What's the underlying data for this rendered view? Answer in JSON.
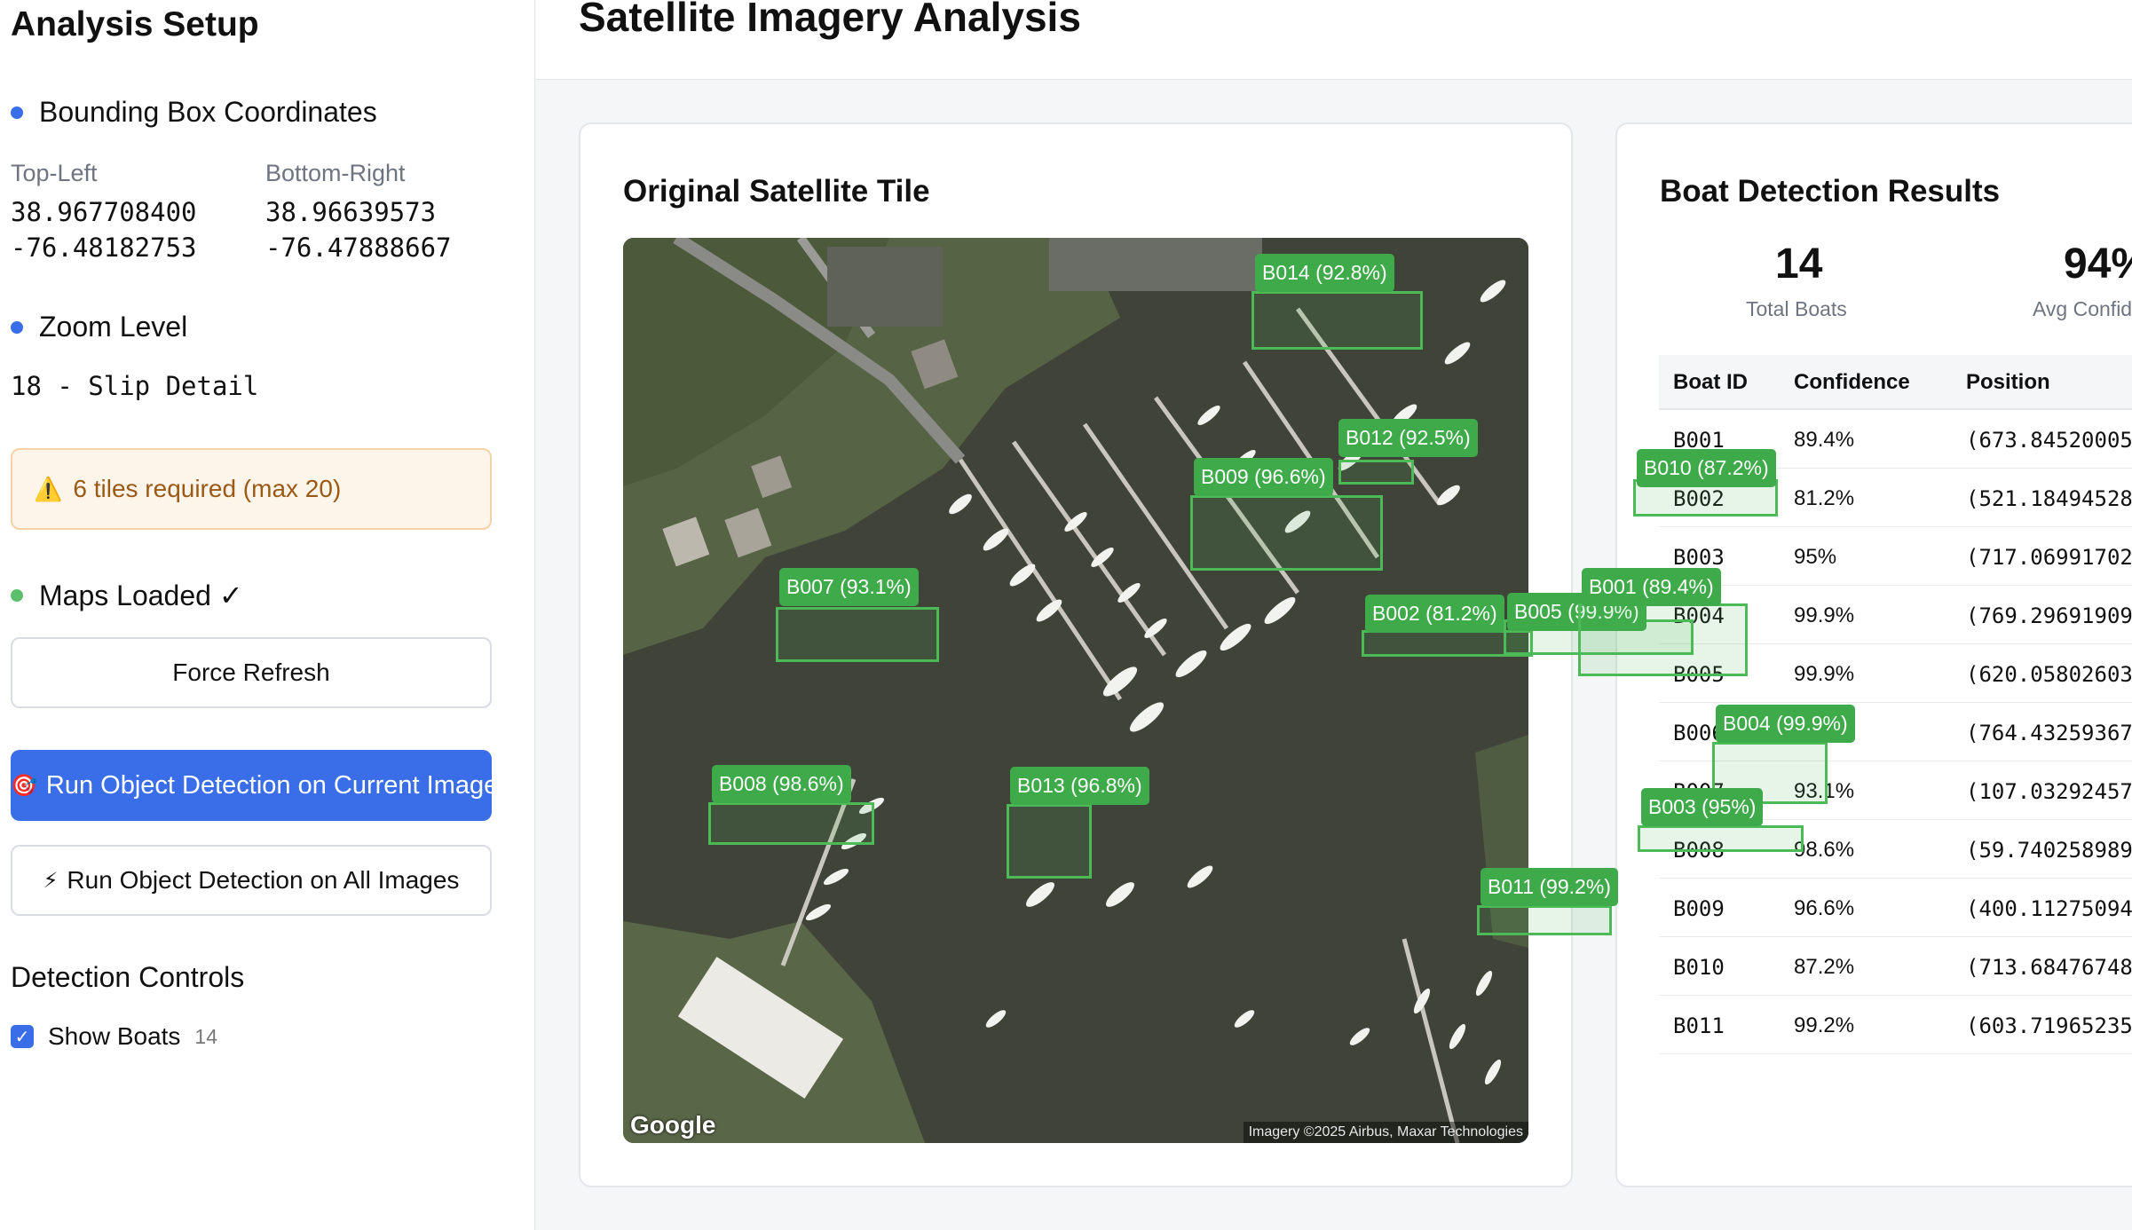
{
  "sidebar": {
    "title": "Analysis Setup",
    "bbox_heading": "Bounding Box Coordinates",
    "top_left_label": "Top-Left",
    "top_left_lat": "38.967708400",
    "top_left_lon": "-76.48182753",
    "bottom_right_label": "Bottom-Right",
    "bottom_right_lat": "38.96639573",
    "bottom_right_lon": "-76.47888667",
    "zoom_heading": "Zoom Level",
    "zoom_value": "18 - Slip Detail",
    "warning_icon": "⚠️",
    "warning_text": "6 tiles required (max 20)",
    "maps_status": "Maps Loaded ✓",
    "force_refresh": "Force Refresh",
    "run_current_icon": "🎯",
    "run_current": "Run Object Detection on Current Image",
    "run_all_icon": "⚡",
    "run_all": "Run Object Detection on All Images",
    "detection_controls": "Detection Controls",
    "show_boats_label": "Show Boats",
    "show_boats_count": "14",
    "colors": {
      "accent": "#3a6ee8",
      "status_dot": "#5cbf6b"
    }
  },
  "header": {
    "title": "Satellite Imagery Analysis"
  },
  "tile": {
    "title": "Original Satellite Tile",
    "google_mark": "Google",
    "attribution": "Imagery ©2025 Airbus, Maxar Technologies"
  },
  "detections": [
    {
      "label": "B014 (92.8%)"
    },
    {
      "label": "B012 (92.5%)"
    },
    {
      "label": "B009 (96.6%)"
    },
    {
      "label": "B007 (93.1%)"
    },
    {
      "label": "B002 (81.2%)"
    },
    {
      "label": "B005 (99.9%)"
    },
    {
      "label": "B001 (89.4%)"
    },
    {
      "label": "B010 (87.2%)"
    },
    {
      "label": "B004 (99.9%)"
    },
    {
      "label": "B003 (95%)"
    },
    {
      "label": "B008 (98.6%)"
    },
    {
      "label": "B013 (96.8%)"
    },
    {
      "label": "B011 (99.2%)"
    }
  ],
  "results": {
    "title": "Boat Detection Results",
    "total_boats": "14",
    "total_boats_label": "Total Boats",
    "avg_conf": "94%",
    "avg_conf_label": "Avg Confidence",
    "columns": [
      "Boat ID",
      "Confidence",
      "Position"
    ],
    "rows": [
      [
        "B001",
        "89.4%",
        "(673.84520005"
      ],
      [
        "B002",
        "81.2%",
        "(521.18494528"
      ],
      [
        "B003",
        "95%",
        "(717.06991702"
      ],
      [
        "B004",
        "99.9%",
        "(769.29691909"
      ],
      [
        "B005",
        "99.9%",
        "(620.05802603"
      ],
      [
        "B006",
        "",
        "(764.43259367"
      ],
      [
        "B007",
        "93.1%",
        "(107.03292457"
      ],
      [
        "B008",
        "98.6%",
        "(59.740258989"
      ],
      [
        "B009",
        "96.6%",
        "(400.11275094"
      ],
      [
        "B010",
        "87.2%",
        "(713.68476748"
      ],
      [
        "B011",
        "99.2%",
        "(603.71965235"
      ]
    ]
  }
}
